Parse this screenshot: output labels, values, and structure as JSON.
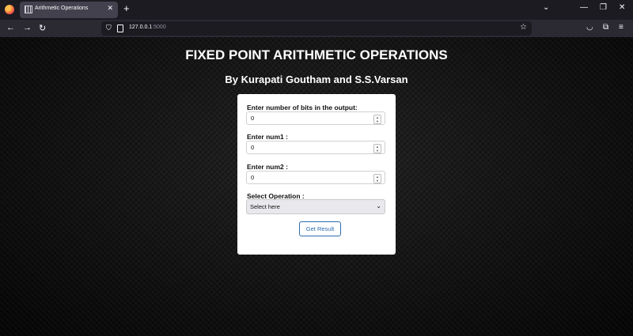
{
  "browser": {
    "tab_title": "Arithmetic Operations",
    "url_host": "127.0.0.1",
    "url_port": ":5000"
  },
  "page": {
    "title": "FIXED POINT ARITHMETIC OPERATIONS",
    "subtitle": "By Kurapati Goutham and S.S.Varsan"
  },
  "form": {
    "bits_label": "Enter number of bits in the output:",
    "bits_value": "0",
    "num1_label": "Enter num1 :",
    "num1_value": "0",
    "num2_label": "Enter num2 :",
    "num2_value": "0",
    "operation_label": "Select Operation :",
    "operation_selected": "Select here",
    "submit_label": "Get Result"
  }
}
